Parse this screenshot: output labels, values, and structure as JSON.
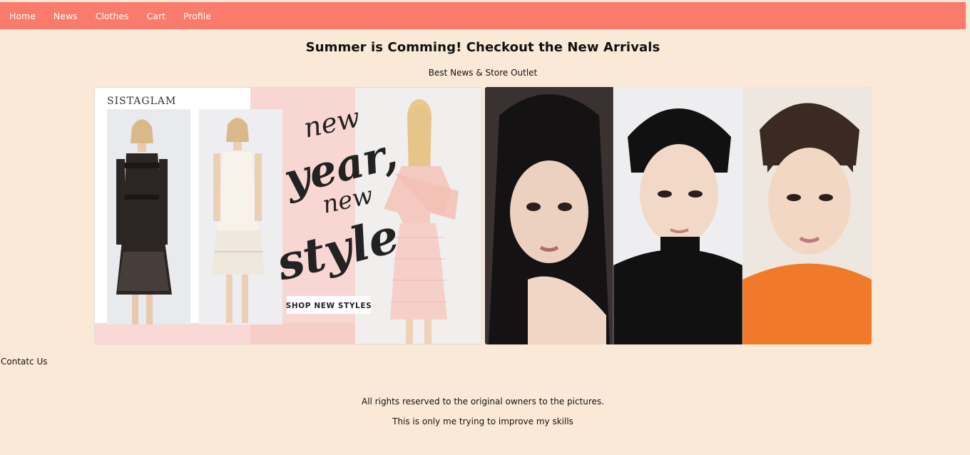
{
  "nav": {
    "items": [
      "Home",
      "News",
      "Clothes",
      "Cart",
      "Profile"
    ]
  },
  "hero": {
    "title": "Summer is Comming! Checkout the New Arrivals",
    "subtitle": "Best News & Store Outlet"
  },
  "left_image": {
    "brand": "SISTAGLAM",
    "script_line1": "new",
    "script_line2": "year,",
    "script_line3": "new",
    "script_line4": "style.",
    "cta": "SHOP NEW STYLES"
  },
  "contact": {
    "label": "Contatc Us"
  },
  "footer": {
    "line1": "All rights reserved to the original owners to the pictures.",
    "line2": "This is only me trying to improve my skills"
  },
  "colors": {
    "nav_bg": "#fa7a6b",
    "page_bg": "#fae9d6",
    "nav_text": "#ffffff"
  }
}
